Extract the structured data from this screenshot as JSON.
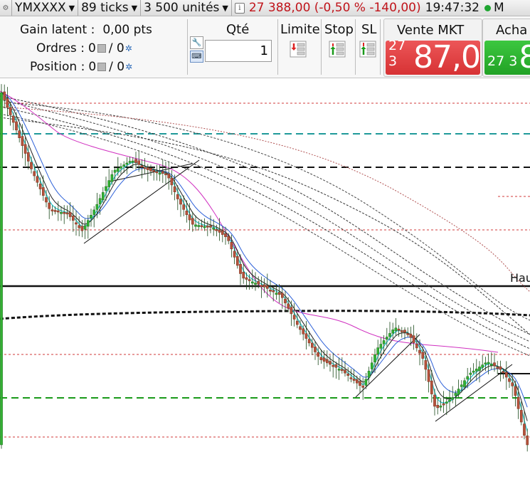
{
  "toolbar": {
    "symbol": "YMXXXX",
    "interval": "89 ticks",
    "quantity_unit": "3 500 unités",
    "info_icon": "i",
    "last_price_change": "27 388,00 (-0,50 % -140,00)",
    "time": "19:47:32",
    "market_status": "M"
  },
  "positions": {
    "gain_label": "Gain latent :",
    "gain_value": "0,00 pts",
    "orders_label": "Ordres :",
    "orders_value": "0",
    "orders_total": "/ 0",
    "position_label": "Position :",
    "position_value": "0",
    "position_total": "/ 0"
  },
  "order": {
    "qty_label": "Qté",
    "qty_value": "1",
    "limit_label": "Limite",
    "stop_label": "Stop",
    "sl_label": "SL"
  },
  "sell": {
    "title": "Vente MKT",
    "price_small": "27 3",
    "price_big": "87,0",
    "color": "#d93436"
  },
  "buy": {
    "title": "Acha",
    "price_small": "27 3",
    "price_big": "8",
    "color": "#27a82a"
  },
  "chart": {
    "level_label": "Hau",
    "bull_color": "#33b233",
    "bear_color": "#b5533b"
  },
  "icons": {
    "dropdown": "chevron-down-icon",
    "info": "info-icon",
    "gear": "gear-icon",
    "wrench": "wrench-icon",
    "keyboard": "keyboard-icon"
  }
}
